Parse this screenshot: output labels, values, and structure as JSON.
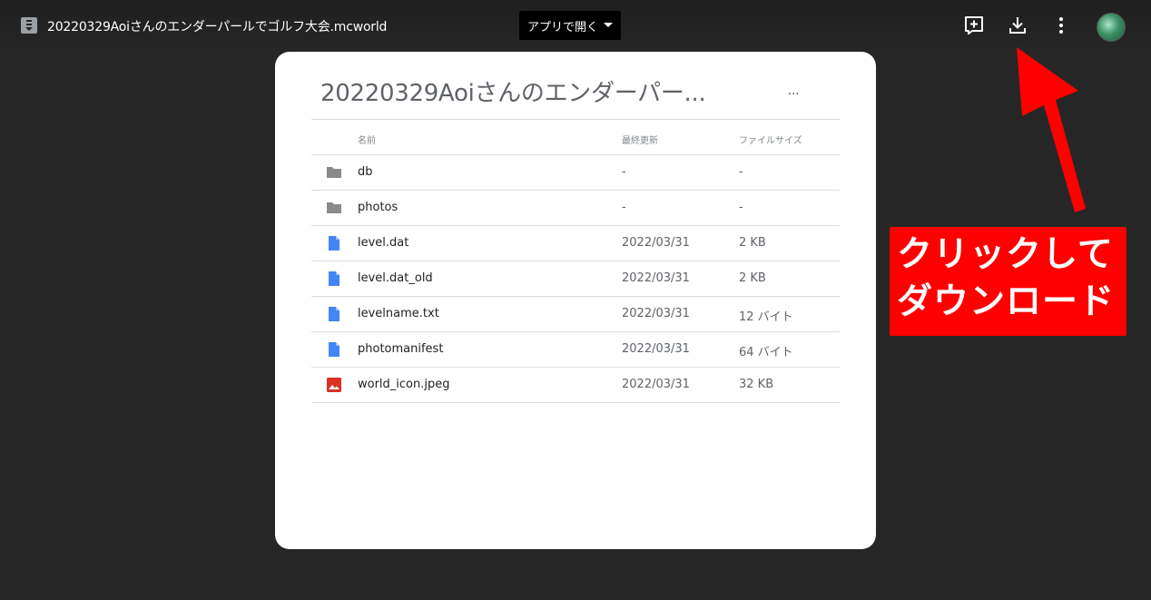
{
  "header": {
    "file_title": "20220329Aoiさんのエンダーパールでゴルフ大会.mcworld",
    "open_with_label": "アプリで開く",
    "icons": [
      "add-to-drive-icon",
      "download-icon",
      "more-vert-icon"
    ]
  },
  "card": {
    "title": "20220329Aoiさんのエンダーパー...",
    "more": "...",
    "columns": {
      "name": "名前",
      "modified": "最終更新",
      "size": "ファイルサイズ"
    },
    "rows": [
      {
        "icon": "folder-icon",
        "name": "db",
        "modified": "-",
        "size": "-"
      },
      {
        "icon": "folder-icon",
        "name": "photos",
        "modified": "-",
        "size": "-"
      },
      {
        "icon": "doc-icon",
        "name": "level.dat",
        "modified": "2022/03/31",
        "size": "2 KB"
      },
      {
        "icon": "doc-icon",
        "name": "level.dat_old",
        "modified": "2022/03/31",
        "size": "2 KB"
      },
      {
        "icon": "doc-icon",
        "name": "levelname.txt",
        "modified": "2022/03/31",
        "size": "12 バイト"
      },
      {
        "icon": "doc-icon",
        "name": "photomanifest",
        "modified": "2022/03/31",
        "size": "64 バイト"
      },
      {
        "icon": "image-icon",
        "name": "world_icon.jpeg",
        "modified": "2022/03/31",
        "size": "32 KB"
      }
    ]
  },
  "annotation": {
    "line1": "クリックして",
    "line2": "ダウンロード",
    "color": "#ff0000"
  }
}
